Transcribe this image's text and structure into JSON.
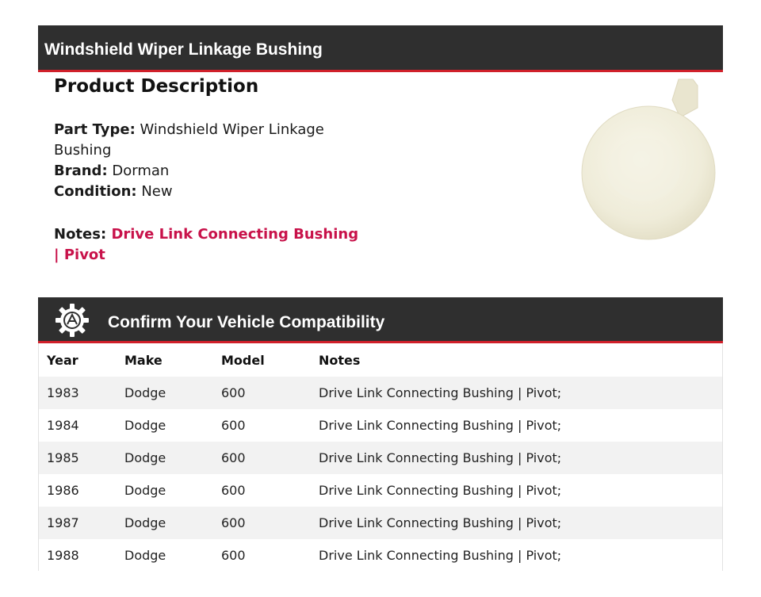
{
  "header": {
    "title": "Windshield Wiper Linkage Bushing"
  },
  "description": {
    "heading": "Product Description",
    "part_type_label": "Part Type:",
    "part_type_value": "Windshield Wiper Linkage Bushing",
    "brand_label": "Brand:",
    "brand_value": "Dorman",
    "condition_label": "Condition:",
    "condition_value": "New",
    "notes_label": "Notes:",
    "notes_value": "Drive Link Connecting Bushing | Pivot"
  },
  "product_image": {
    "icon": "bushing-product-image"
  },
  "compatibility": {
    "title": "Confirm Your Vehicle Compatibility",
    "icon": "gear-icon",
    "columns": [
      "Year",
      "Make",
      "Model",
      "Notes"
    ],
    "rows": [
      [
        "1983",
        "Dodge",
        "600",
        "Drive Link Connecting Bushing | Pivot;"
      ],
      [
        "1984",
        "Dodge",
        "600",
        "Drive Link Connecting Bushing | Pivot;"
      ],
      [
        "1985",
        "Dodge",
        "600",
        "Drive Link Connecting Bushing | Pivot;"
      ],
      [
        "1986",
        "Dodge",
        "600",
        "Drive Link Connecting Bushing | Pivot;"
      ],
      [
        "1987",
        "Dodge",
        "600",
        "Drive Link Connecting Bushing | Pivot;"
      ],
      [
        "1988",
        "Dodge",
        "600",
        "Drive Link Connecting Bushing | Pivot;"
      ]
    ]
  },
  "colors": {
    "bar": "#2f2f2f",
    "accent_line": "#d0202a",
    "notes_accent": "#c8124a"
  }
}
